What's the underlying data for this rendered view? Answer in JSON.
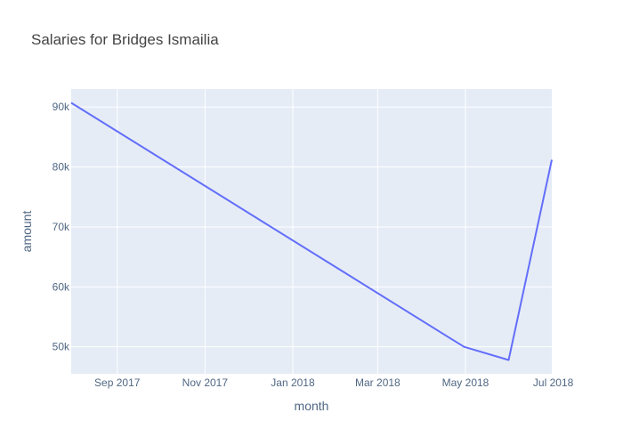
{
  "chart_data": {
    "type": "line",
    "title": "Salaries for Bridges Ismailia",
    "xlabel": "month",
    "ylabel": "amount",
    "x_ticks": [
      "Sep 2017",
      "Nov 2017",
      "Jan 2018",
      "Mar 2018",
      "May 2018",
      "Jul 2018"
    ],
    "y_ticks": [
      "50k",
      "60k",
      "70k",
      "80k",
      "90k"
    ],
    "x_range": [
      "2017-07-31",
      "2018-06-30"
    ],
    "y_range": [
      45500,
      93000
    ],
    "series": [
      {
        "x": [
          "2017-07-31",
          "2018-04-30",
          "2018-05-31",
          "2018-06-30"
        ],
        "values": [
          90700,
          50000,
          47800,
          81200
        ]
      }
    ],
    "grid": true,
    "colors": {
      "line": "#636efa",
      "plot_bg": "#e5ecf6",
      "grid": "#ffffff"
    }
  }
}
